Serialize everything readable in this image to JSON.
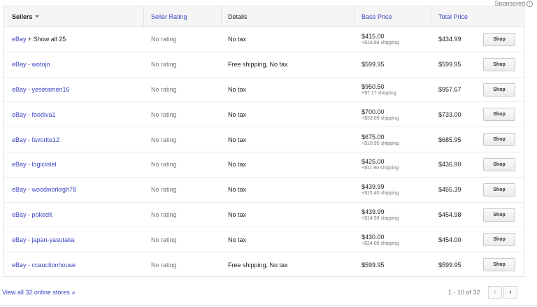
{
  "sponsored": {
    "label": "Sponsored",
    "info_glyph": "i"
  },
  "table": {
    "headers": {
      "sellers": "Sellers",
      "seller_rating": "Seller Rating",
      "details": "Details",
      "base_price": "Base Price",
      "total_price": "Total Price"
    },
    "rows": [
      {
        "seller": "eBay",
        "seller_suffix": " + Show all 25",
        "rating": "No rating",
        "details": "No tax",
        "base": "$415.00",
        "shipping": "+$19.99 shipping",
        "total": "$434.99",
        "shop": "Shop"
      },
      {
        "seller": "eBay - wotojo",
        "seller_suffix": "",
        "rating": "No rating",
        "details": "Free shipping, No tax",
        "base": "$599.95",
        "shipping": "",
        "total": "$599.95",
        "shop": "Shop"
      },
      {
        "seller": "eBay - yesetamen16",
        "seller_suffix": "",
        "rating": "No rating",
        "details": "No tax",
        "base": "$950.50",
        "shipping": "+$7.17 shipping",
        "total": "$957.67",
        "shop": "Shop"
      },
      {
        "seller": "eBay - foodiva1",
        "seller_suffix": "",
        "rating": "No rating",
        "details": "No tax",
        "base": "$700.00",
        "shipping": "+$33.00 shipping",
        "total": "$733.00",
        "shop": "Shop"
      },
      {
        "seller": "eBay - favorite12",
        "seller_suffix": "",
        "rating": "No rating",
        "details": "No tax",
        "base": "$675.00",
        "shipping": "+$10.95 shipping",
        "total": "$685.95",
        "shop": "Shop"
      },
      {
        "seller": "eBay - logicintel",
        "seller_suffix": "",
        "rating": "No rating",
        "details": "No tax",
        "base": "$425.00",
        "shipping": "+$11.90 shipping",
        "total": "$436.90",
        "shop": "Shop"
      },
      {
        "seller": "eBay - woodworkrgh78",
        "seller_suffix": "",
        "rating": "No rating",
        "details": "No tax",
        "base": "$439.99",
        "shipping": "+$15.40 shipping",
        "total": "$455.39",
        "shop": "Shop"
      },
      {
        "seller": "eBay - pokedit",
        "seller_suffix": "",
        "rating": "No rating",
        "details": "No tax",
        "base": "$439.99",
        "shipping": "+$14.99 shipping",
        "total": "$454.98",
        "shop": "Shop"
      },
      {
        "seller": "eBay - japan-yasutaka",
        "seller_suffix": "",
        "rating": "No rating",
        "details": "No tax",
        "base": "$430.00",
        "shipping": "+$24.00 shipping",
        "total": "$454.00",
        "shop": "Shop"
      },
      {
        "seller": "eBay - ccauctionhouse",
        "seller_suffix": "",
        "rating": "No rating",
        "details": "Free shipping, No tax",
        "base": "$599.95",
        "shipping": "",
        "total": "$599.95",
        "shop": "Shop"
      }
    ]
  },
  "footer": {
    "view_all": "View all 32 online stores »",
    "pager_text": "1 - 10 of 32",
    "prev_glyph": "‹",
    "next_glyph": "›"
  },
  "colors": {
    "link": "#3b46c4",
    "muted": "#767676",
    "header_bg": "#f5f5f5"
  }
}
